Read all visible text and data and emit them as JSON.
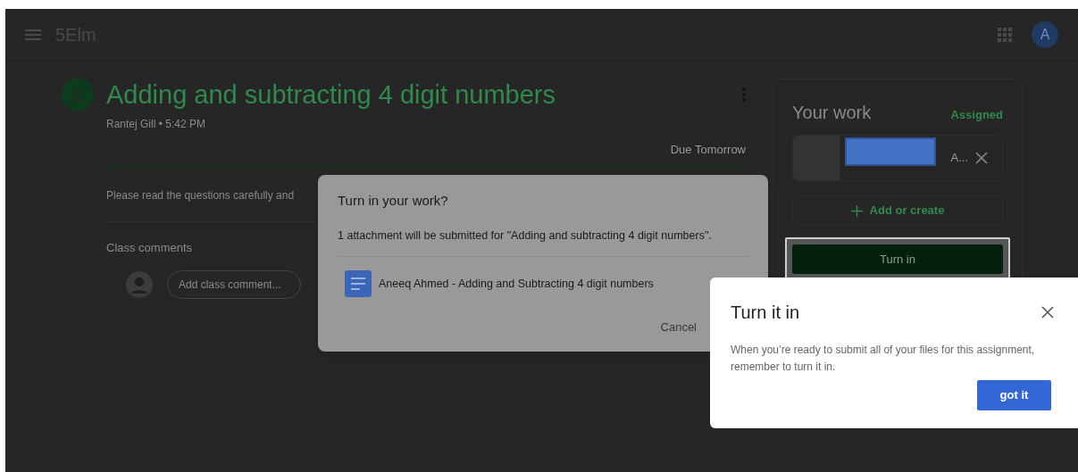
{
  "header": {
    "title": "5Elm",
    "avatar_letter": "A"
  },
  "assignment": {
    "title": "Adding and subtracting 4 digit numbers",
    "meta": "Rantej Gill • 5:42 PM",
    "due": "Due Tomorrow",
    "instructions": "Please read the questions carefully and",
    "comments_heading": "Class comments",
    "comment_placeholder": "Add class comment..."
  },
  "your_work": {
    "title": "Your work",
    "status": "Assigned",
    "attachment": {
      "name": "A...",
      "redacted": true
    },
    "add_label": "Add or create",
    "turn_in_label": "Turn in",
    "turn_in_highlighted": true
  },
  "dialog": {
    "title": "Turn in your work?",
    "message": "1 attachment will be submitted for \"Adding and subtracting 4 digit numbers\".",
    "attachments": [
      {
        "name": "Aneeq Ahmed - Adding and Subtracting 4 digit numbers"
      }
    ],
    "buttons": [
      "Cancel"
    ]
  },
  "tooltip": {
    "title": "Turn it in",
    "message": "When you’re ready to submit all of your files for this assignment, remember to turn it in.",
    "button": "got it"
  }
}
